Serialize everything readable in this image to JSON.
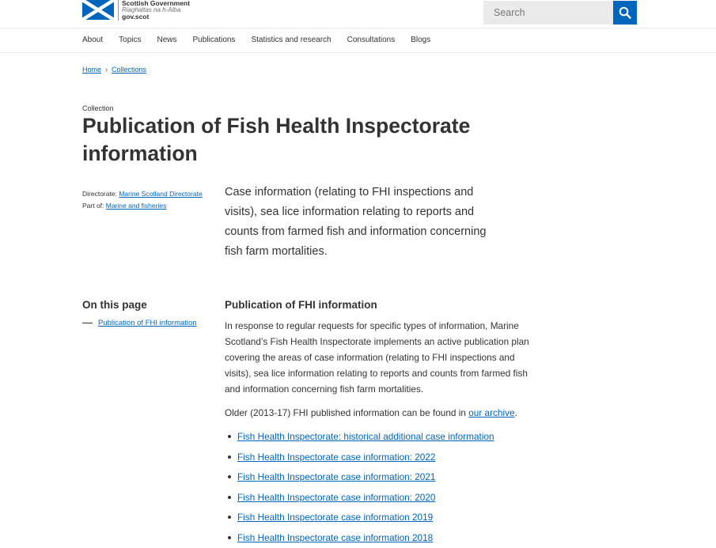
{
  "header": {
    "logo": {
      "line1": "Scottish Government",
      "line2": "Riaghaltas na h-Alba",
      "line3": "gov.scot"
    },
    "search": {
      "placeholder": "Search",
      "icon": "search-icon"
    }
  },
  "nav": {
    "items": [
      "About",
      "Topics",
      "News",
      "Publications",
      "Statistics and research",
      "Consultations",
      "Blogs"
    ]
  },
  "breadcrumb": {
    "items": [
      "Home",
      "Collections"
    ],
    "separator": "›"
  },
  "page": {
    "kicker": "Collection",
    "title": "Publication of Fish Health Inspectorate information",
    "meta": {
      "directorate_label": "Directorate:",
      "directorate_link": "Marine Scotland Directorate",
      "partof_label": "Part of:",
      "partof_link": "Marine and fisheries"
    },
    "lede": "Case information (relating to FHI inspections and visits), sea lice information relating to reports and counts from farmed fish and information concerning fish farm mortalities."
  },
  "on_this_page": {
    "title": "On this page",
    "items": [
      "Publication of FHI information"
    ]
  },
  "section": {
    "title": "Publication of FHI information",
    "paragraph": "In response to regular requests for specific types of information, Marine Scotland’s Fish Health Inspectorate implements an active publication plan covering the areas of case information (relating to FHI inspections and visits), sea lice information relating to reports and counts from farmed fish and information concerning fish farm mortalities.",
    "archive_prefix": "Older (2013-17) FHI published information can be found in ",
    "archive_link": "our archive",
    "archive_suffix": ".",
    "links": [
      "Fish Health Inspectorate: historical additional case information",
      "Fish Health Inspectorate case information: 2022",
      "Fish Health Inspectorate case information: 2021",
      "Fish Health Inspectorate case information: 2020",
      "Fish Health Inspectorate case information 2019",
      "Fish Health Inspectorate case information 2018"
    ]
  },
  "colors": {
    "brand_blue": "#0065bd",
    "text": "#333333",
    "search_bg": "#ebebeb"
  }
}
